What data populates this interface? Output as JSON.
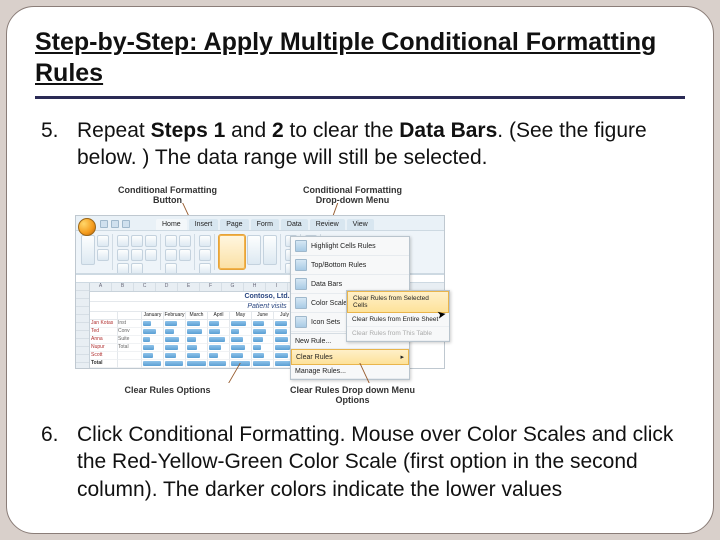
{
  "title": "Step-by-Step: Apply Multiple Conditional Formatting Rules",
  "steps": {
    "five": {
      "num": "5.",
      "parts": [
        "Repeat ",
        "Steps 1",
        " and ",
        "2",
        " to clear the ",
        "Data Bars",
        ". (See the figure below. ) The data range will still be selected."
      ]
    },
    "six": {
      "num": "6.",
      "text": "Click Conditional Formatting. Mouse over Color Scales and click the Red-Yellow-Green Color Scale (first option in the second column). The darker colors indicate the lower values"
    }
  },
  "callouts": {
    "top_left": "Conditional Formatting Button",
    "top_right": "Conditional Formatting Drop-down Menu",
    "bottom_left": "Clear Rules Options",
    "bottom_right": "Clear Rules Drop down Menu Options"
  },
  "excel": {
    "tabs": [
      "Home",
      "Insert",
      "Page",
      "Form",
      "Data",
      "Review",
      "View"
    ],
    "sheet_title1": "Contoso, Ltd.",
    "sheet_title2": "Patient visits",
    "columns": [
      "",
      "",
      "",
      "January",
      "February",
      "March",
      "April",
      "May",
      "June",
      "July"
    ],
    "row_labels": [
      "Jan Kotas",
      "Ted",
      "Anna",
      "Nupur",
      "Scott",
      "Total"
    ],
    "sub_labels": [
      "Inst",
      "Conv",
      "Suite",
      "Total"
    ]
  },
  "menu": {
    "items": [
      "Highlight Cells Rules",
      "Top/Bottom Rules",
      "Data Bars",
      "Color Scales",
      "Icon Sets"
    ],
    "lower": [
      "New Rule...",
      "Clear Rules",
      "Manage Rules..."
    ],
    "submenu": [
      "Clear Rules from Selected Cells",
      "Clear Rules from Entire Sheet",
      "Clear Rules from This Table"
    ]
  }
}
